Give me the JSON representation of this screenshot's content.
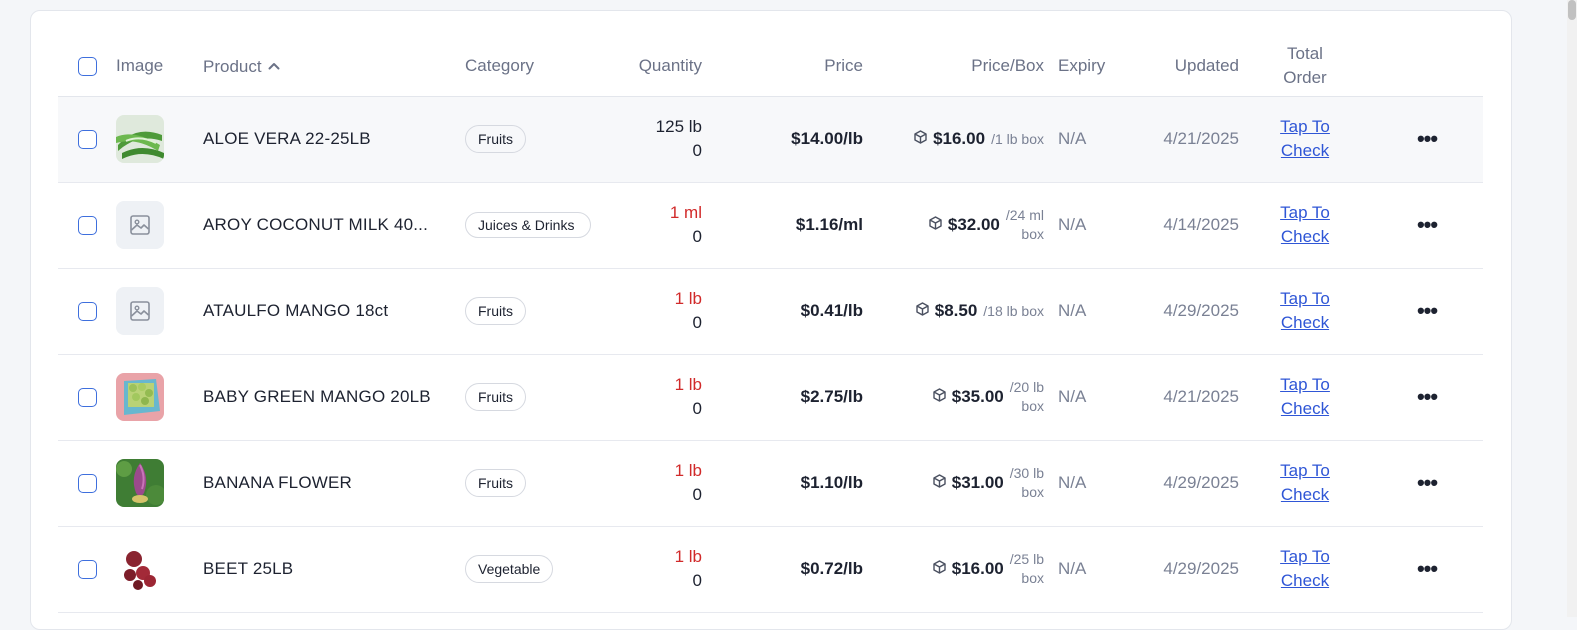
{
  "headers": {
    "image": "Image",
    "product": "Product",
    "category": "Category",
    "quantity": "Quantity",
    "price": "Price",
    "price_box": "Price/Box",
    "expiry": "Expiry",
    "updated": "Updated",
    "total_order_1": "Total",
    "total_order_2": "Order"
  },
  "sort_icon": "chevron-up-icon",
  "box_icon": "box-icon",
  "colors": {
    "accent": "#3e6fdd",
    "link": "#2f56d6",
    "alert": "#d12a2a"
  },
  "rows": [
    {
      "product": "ALOE VERA 22-25LB",
      "image": "aloe-vera-photo",
      "category": "Fruits",
      "qty_top": "125 lb",
      "qty_bottom": "0",
      "price": "$14.00/lb",
      "box_price": "$16.00",
      "box_unit_1": "/1 lb box",
      "box_unit_2": "",
      "expiry": "N/A",
      "updated": "4/21/2025",
      "tap_1": "Tap To",
      "tap_2": "Check"
    },
    {
      "product": "AROY COCONUT MILK 40...",
      "image": "placeholder-image-icon",
      "category": "Juices & Drinks",
      "qty_top": "1 ml",
      "qty_bottom": "0",
      "price": "$1.16/ml",
      "box_price": "$32.00",
      "box_unit_1": "/24 ml",
      "box_unit_2": "box",
      "expiry": "N/A",
      "updated": "4/14/2025",
      "tap_1": "Tap To",
      "tap_2": "Check"
    },
    {
      "product": "ATAULFO MANGO 18ct",
      "image": "placeholder-image-icon",
      "category": "Fruits",
      "qty_top": "1 lb",
      "qty_bottom": "0",
      "price": "$0.41/lb",
      "box_price": "$8.50",
      "box_unit_1": "/18 lb box",
      "box_unit_2": "",
      "expiry": "N/A",
      "updated": "4/29/2025",
      "tap_1": "Tap To",
      "tap_2": "Check"
    },
    {
      "product": "BABY GREEN MANGO 20LB",
      "image": "green-mango-photo",
      "category": "Fruits",
      "qty_top": "1 lb",
      "qty_bottom": "0",
      "price": "$2.75/lb",
      "box_price": "$35.00",
      "box_unit_1": "/20 lb",
      "box_unit_2": "box",
      "expiry": "N/A",
      "updated": "4/21/2025",
      "tap_1": "Tap To",
      "tap_2": "Check"
    },
    {
      "product": "BANANA FLOWER",
      "image": "banana-flower-photo",
      "category": "Fruits",
      "qty_top": "1 lb",
      "qty_bottom": "0",
      "price": "$1.10/lb",
      "box_price": "$31.00",
      "box_unit_1": "/30 lb",
      "box_unit_2": "box",
      "expiry": "N/A",
      "updated": "4/29/2025",
      "tap_1": "Tap To",
      "tap_2": "Check"
    },
    {
      "product": "BEET 25LB",
      "image": "beet-photo",
      "category": "Vegetable",
      "qty_top": "1 lb",
      "qty_bottom": "0",
      "price": "$0.72/lb",
      "box_price": "$16.00",
      "box_unit_1": "/25 lb",
      "box_unit_2": "box",
      "expiry": "N/A",
      "updated": "4/29/2025",
      "tap_1": "Tap To",
      "tap_2": "Check"
    }
  ]
}
